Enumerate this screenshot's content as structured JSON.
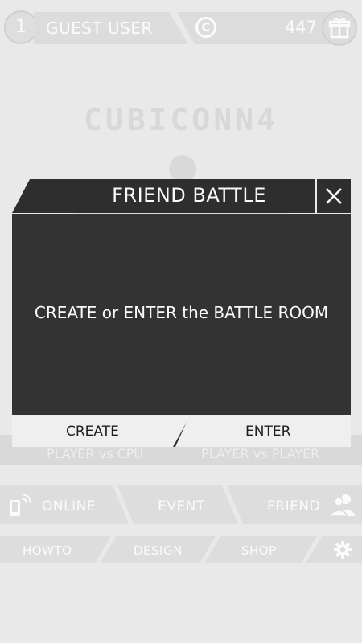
{
  "top_bar": {
    "level": "1",
    "guest_label": "GUEST USER",
    "coin_symbol": "C",
    "coin_count": "447"
  },
  "logo_text": "CUBICONN4",
  "modes": {
    "player_vs_cpu": "PLAYER vs CPU",
    "player_vs_player": "PLAYER vs PLAYER"
  },
  "menu": {
    "online": "ONLINE",
    "event": "EVENT",
    "friend": "FRIEND",
    "howto": "HOWTO",
    "design": "DESIGN",
    "shop": "SHOP"
  },
  "dialog": {
    "title": "FRIEND BATTLE",
    "message": "CREATE or ENTER the BATTLE ROOM",
    "create_label": "CREATE",
    "enter_label": "ENTER"
  },
  "icons": [
    "gift-icon",
    "coin-icon",
    "close-icon",
    "phone-signal-icon",
    "people-icon",
    "gear-icon"
  ]
}
